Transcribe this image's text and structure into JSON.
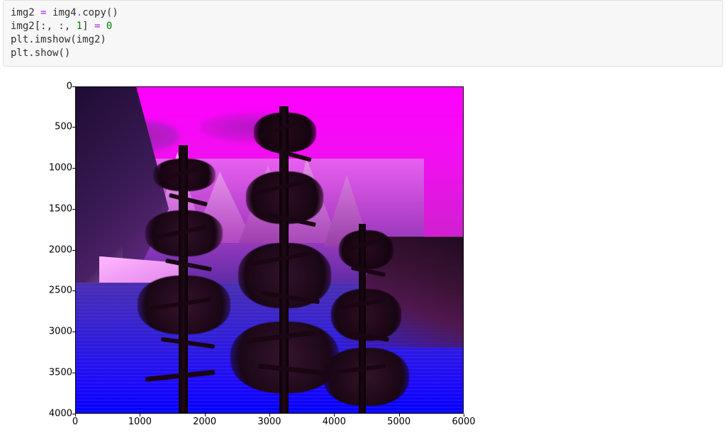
{
  "code": {
    "line1_a": "img2 ",
    "line1_b": " img4",
    "line1_c": "copy()",
    "line2_a": "img2[:, :, ",
    "line2_num1": "1",
    "line2_b": "] ",
    "line2_c": " ",
    "line2_num2": "0",
    "line3": "plt.imshow(img2)",
    "line4": "plt.show()",
    "op_eq": "=",
    "op_dot": "."
  },
  "chart_data": {
    "type": "image",
    "description": "RGB landscape image displayed with green channel set to 0 (magenta/blue tint)",
    "xlim": [
      0,
      6000
    ],
    "ylim": [
      4000,
      0
    ],
    "x_ticks": [
      0,
      1000,
      2000,
      3000,
      4000,
      5000,
      6000
    ],
    "y_ticks": [
      0,
      500,
      1000,
      1500,
      2000,
      2500,
      3000,
      3500,
      4000
    ],
    "image_shape_approx": [
      4000,
      6000,
      3
    ],
    "channel_modification": {
      "channel": 1,
      "value": 0
    }
  },
  "yticks": {
    "t0": "0",
    "t1": "500",
    "t2": "1000",
    "t3": "1500",
    "t4": "2000",
    "t5": "2500",
    "t6": "3000",
    "t7": "3500",
    "t8": "4000"
  },
  "xticks": {
    "t0": "0",
    "t1": "1000",
    "t2": "2000",
    "t3": "3000",
    "t4": "4000",
    "t5": "5000",
    "t6": "6000"
  }
}
